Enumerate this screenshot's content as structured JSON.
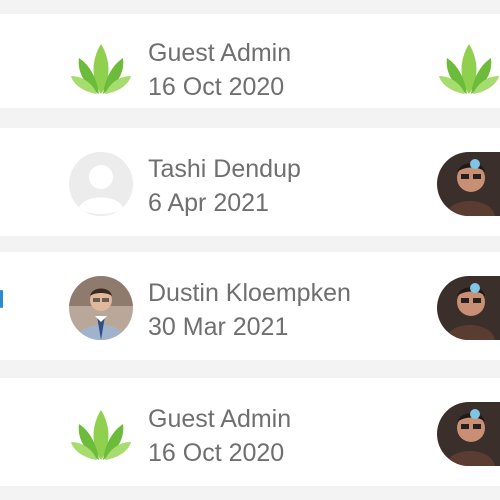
{
  "activity": {
    "rows": [
      {
        "name": "Guest Admin",
        "date": "16 Oct 2020",
        "avatar_icon": "green-leaf-logo-icon",
        "right_icon": "green-leaf-logo-icon"
      },
      {
        "name": "Tashi Dendup",
        "date": "6 Apr 2021",
        "avatar_icon": "default-user-avatar-icon",
        "right_icon": "user-photo-avatar"
      },
      {
        "name": "Dustin Kloempken",
        "date": "30 Mar 2021",
        "avatar_icon": "user-photo-avatar",
        "right_icon": "user-photo-avatar"
      },
      {
        "name": "Guest Admin",
        "date": "16 Oct 2020",
        "avatar_icon": "green-leaf-logo-icon",
        "right_icon": "user-photo-avatar"
      }
    ]
  },
  "colors": {
    "background": "#f3f3f3",
    "row": "#ffffff",
    "text": "#6f6f6f",
    "leaf_green": "#6dbb3a",
    "accent_blue": "#2a8bd0"
  }
}
